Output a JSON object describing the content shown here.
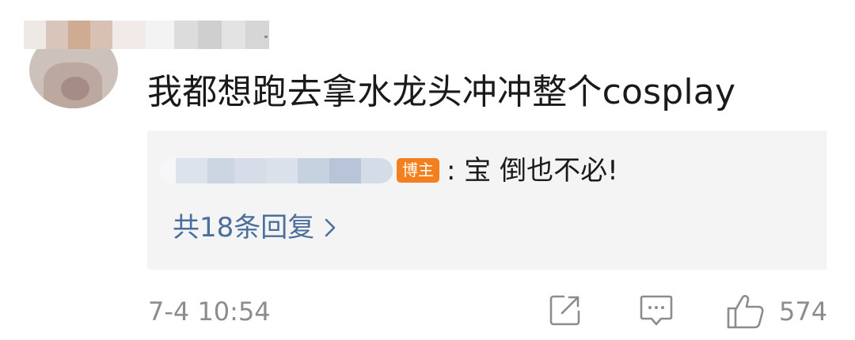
{
  "comment": {
    "text": "我都想跑去拿水龙头冲冲整个cosplay",
    "timestamp": "7-4 10:54",
    "like_count": "574"
  },
  "reply": {
    "owner_badge": "博主",
    "text": ": 宝 倒也不必!",
    "view_replies": "共18条回复"
  },
  "icons": {
    "share": "share-icon",
    "comment": "comment-icon",
    "like": "thumbs-up-icon",
    "chevron": "chevron-right-icon"
  },
  "colors": {
    "badge": "#f37f1e",
    "link": "#4b6f9c",
    "meta": "#8c8c8c",
    "reply_bg": "#f4f4f4"
  }
}
